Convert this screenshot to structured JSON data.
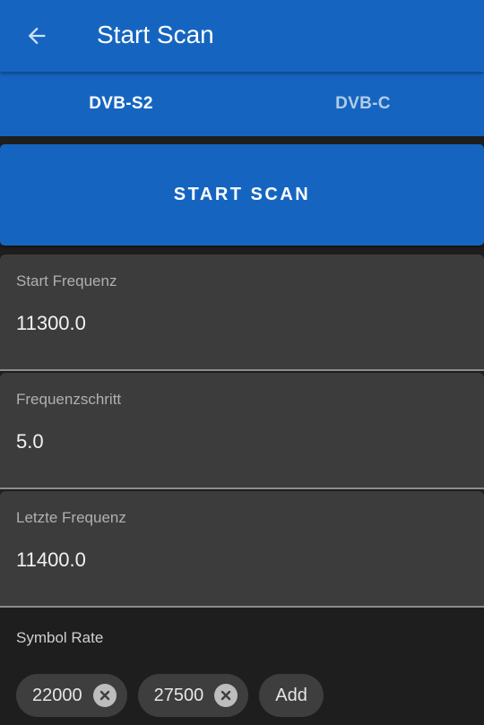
{
  "appbar": {
    "back_icon": "arrow-left-icon",
    "title": "Start Scan"
  },
  "tabs": [
    {
      "label": "DVB-S2",
      "active": true
    },
    {
      "label": "DVB-C",
      "active": false
    }
  ],
  "start_button": {
    "label": "START SCAN"
  },
  "fields": {
    "start_frequency": {
      "label": "Start Frequenz",
      "value": "11300.0"
    },
    "frequency_step": {
      "label": "Frequenzschritt",
      "value": "5.0"
    },
    "last_frequency": {
      "label": "Letzte Frequenz",
      "value": "11400.0"
    }
  },
  "symbol_rate": {
    "label": "Symbol Rate",
    "chips": [
      {
        "value": "22000",
        "remove_icon": "close-circle-icon"
      },
      {
        "value": "27500",
        "remove_icon": "close-circle-icon"
      }
    ],
    "add_label": "Add"
  },
  "colors": {
    "primary": "#1565c0",
    "background": "#1e1e1e",
    "field_background": "#3c3c3c",
    "chip_background": "#3e3e3e"
  }
}
